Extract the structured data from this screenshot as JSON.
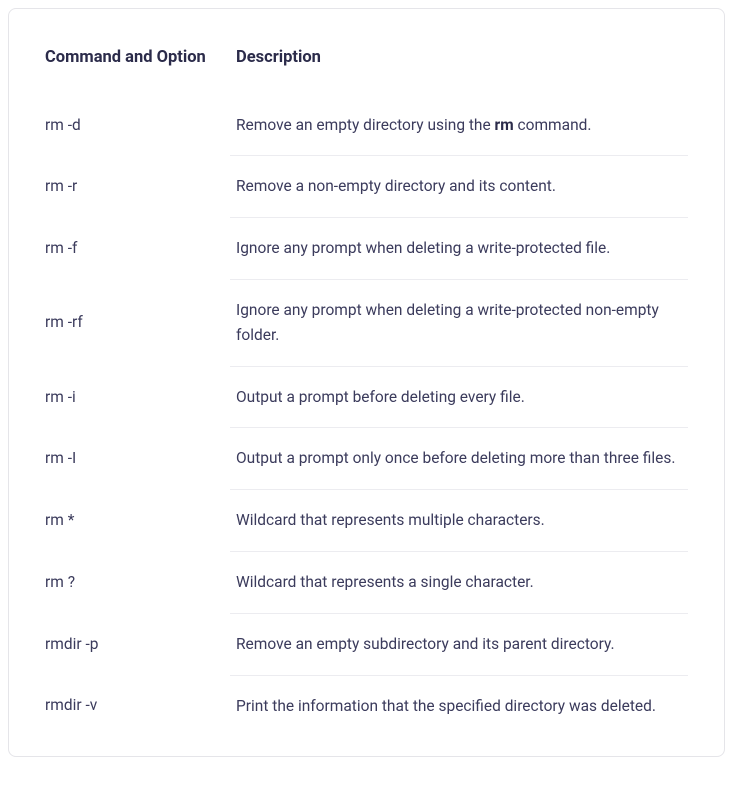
{
  "table": {
    "headers": {
      "command": "Command and Option",
      "description": "Description"
    },
    "rows": [
      {
        "command": "rm -d",
        "description_pre": "Remove an empty directory using the ",
        "description_bold": "rm",
        "description_post": " command."
      },
      {
        "command": "rm -r",
        "description_pre": "Remove a non-empty directory and its content.",
        "description_bold": "",
        "description_post": ""
      },
      {
        "command": "rm -f",
        "description_pre": "Ignore any prompt when deleting a write-protected file.",
        "description_bold": "",
        "description_post": ""
      },
      {
        "command": "rm -rf",
        "description_pre": "Ignore any prompt when deleting a write-protected non-empty folder.",
        "description_bold": "",
        "description_post": ""
      },
      {
        "command": "rm -i",
        "description_pre": "Output a prompt before deleting every file.",
        "description_bold": "",
        "description_post": ""
      },
      {
        "command": "rm -I",
        "description_pre": "Output a prompt only once before deleting more than three files.",
        "description_bold": "",
        "description_post": ""
      },
      {
        "command": "rm *",
        "description_pre": "Wildcard that represents multiple characters.",
        "description_bold": "",
        "description_post": ""
      },
      {
        "command": "rm ?",
        "description_pre": "Wildcard that represents a single character.",
        "description_bold": "",
        "description_post": ""
      },
      {
        "command": "rmdir -p",
        "description_pre": "Remove an empty subdirectory and its parent directory.",
        "description_bold": "",
        "description_post": ""
      },
      {
        "command": "rmdir -v",
        "description_pre": "Print the information that the specified directory was deleted.",
        "description_bold": "",
        "description_post": ""
      }
    ]
  }
}
